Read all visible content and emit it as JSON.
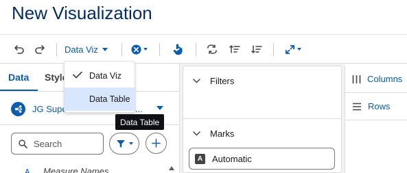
{
  "page": {
    "title": "New Visualization"
  },
  "toolbar": {
    "undo_icon": "undo-icon",
    "redo_icon": "redo-icon",
    "viz_type_label": "Data Viz",
    "clear_icon": "close-circle-icon",
    "touch_icon": "pointer-icon",
    "swap_icon": "swap-icon",
    "sort_asc_icon": "sort-ascending-icon",
    "sort_desc_icon": "sort-descending-icon",
    "expand_icon": "expand-icon"
  },
  "left": {
    "tabs": [
      {
        "label": "Data"
      },
      {
        "label": "Style"
      }
    ],
    "dataset": {
      "label": "JG Supe",
      "suffix": "...",
      "icon": "dataset-icon"
    },
    "search": {
      "placeholder": "Search"
    },
    "fields": [
      {
        "label": "Measure Names",
        "icon": "text-field-icon"
      }
    ]
  },
  "mid": {
    "filters_label": "Filters",
    "marks_label": "Marks",
    "mark_type": "Automatic"
  },
  "right": {
    "columns_label": "Columns",
    "rows_label": "Rows"
  },
  "dropdown": {
    "items": [
      {
        "label": "Data Viz",
        "checked": true
      },
      {
        "label": "Data Table",
        "checked": false
      }
    ]
  },
  "tooltip": {
    "text": "Data Table"
  },
  "colors": {
    "brand": "#0b5cab",
    "title": "#032d60",
    "highlight": "#d8e6fe"
  }
}
